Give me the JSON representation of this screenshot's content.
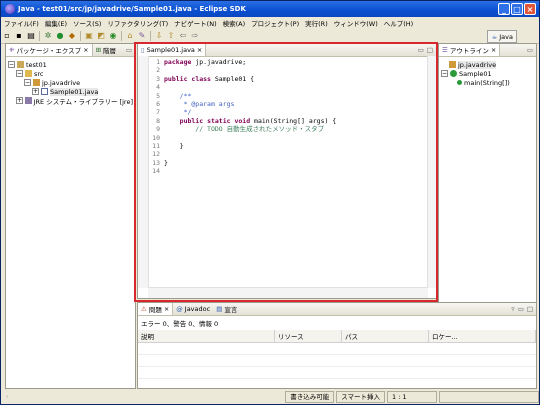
{
  "window": {
    "title": "Java - test01/src/jp/javadrive/Sample01.java - Eclipse SDK"
  },
  "menu": [
    "ファイル(F)",
    "編集(E)",
    "ソース(S)",
    "リファクタリング(T)",
    "ナビゲート(N)",
    "検索(A)",
    "プロジェクト(P)",
    "実行(R)",
    "ウィンドウ(W)",
    "ヘルプ(H)"
  ],
  "toolbar": {
    "perspective_label": "Java"
  },
  "package_explorer": {
    "tabs": [
      "パッケージ・エクスプ",
      "階層"
    ],
    "tree": [
      "test01",
      "src",
      "jp.javadrive",
      "Sample01.java",
      "JRE システム・ライブラリー [jre]"
    ]
  },
  "editor": {
    "tab": "Sample01.java",
    "lines": [
      {
        "n": "1",
        "t": "package jp.javadrive;"
      },
      {
        "n": "2",
        "t": ""
      },
      {
        "n": "3",
        "t": "public class Sample01 {"
      },
      {
        "n": "4",
        "t": ""
      },
      {
        "n": "5",
        "t": "    /**"
      },
      {
        "n": "6",
        "t": "     * @param args"
      },
      {
        "n": "7",
        "t": "     */"
      },
      {
        "n": "8",
        "t": "    public static void main(String[] args) {"
      },
      {
        "n": "9",
        "t": "        // TODO 自動生成されたメソッド・スタブ"
      },
      {
        "n": "10",
        "t": ""
      },
      {
        "n": "11",
        "t": "    }"
      },
      {
        "n": "12",
        "t": ""
      },
      {
        "n": "13",
        "t": "}"
      },
      {
        "n": "14",
        "t": ""
      }
    ]
  },
  "outline": {
    "tab": "アウトライン",
    "tree": [
      "jp.javadrive",
      "Sample01",
      "main(String[])"
    ]
  },
  "problems": {
    "tabs": [
      "問題",
      "Javadoc",
      "宣言"
    ],
    "summary": "エラー 0、警告 0、情報 0",
    "columns": [
      "説明",
      "リソース",
      "パス",
      "ロケー..."
    ]
  },
  "status": {
    "writable": "書き込み可能",
    "insert_mode": "スマート挿入",
    "position": "1 : 1"
  }
}
